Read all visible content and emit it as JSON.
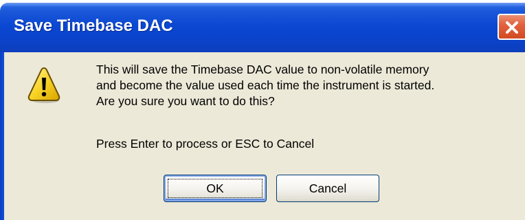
{
  "dialog": {
    "title": "Save Timebase DAC",
    "icon": "warning-icon",
    "message_lines": [
      "This will save the Timebase DAC value to non-volatile memory",
      "and become the value used each time the instrument is started.",
      "Are you sure you want to do this?"
    ],
    "prompt": "Press Enter to process or ESC to Cancel",
    "buttons": {
      "ok_label": "OK",
      "cancel_label": "Cancel"
    }
  },
  "colors": {
    "titlebar": "#0a43cc",
    "body": "#ece9d8",
    "close_button": "#d9532c",
    "warning_fill": "#f7d325"
  }
}
